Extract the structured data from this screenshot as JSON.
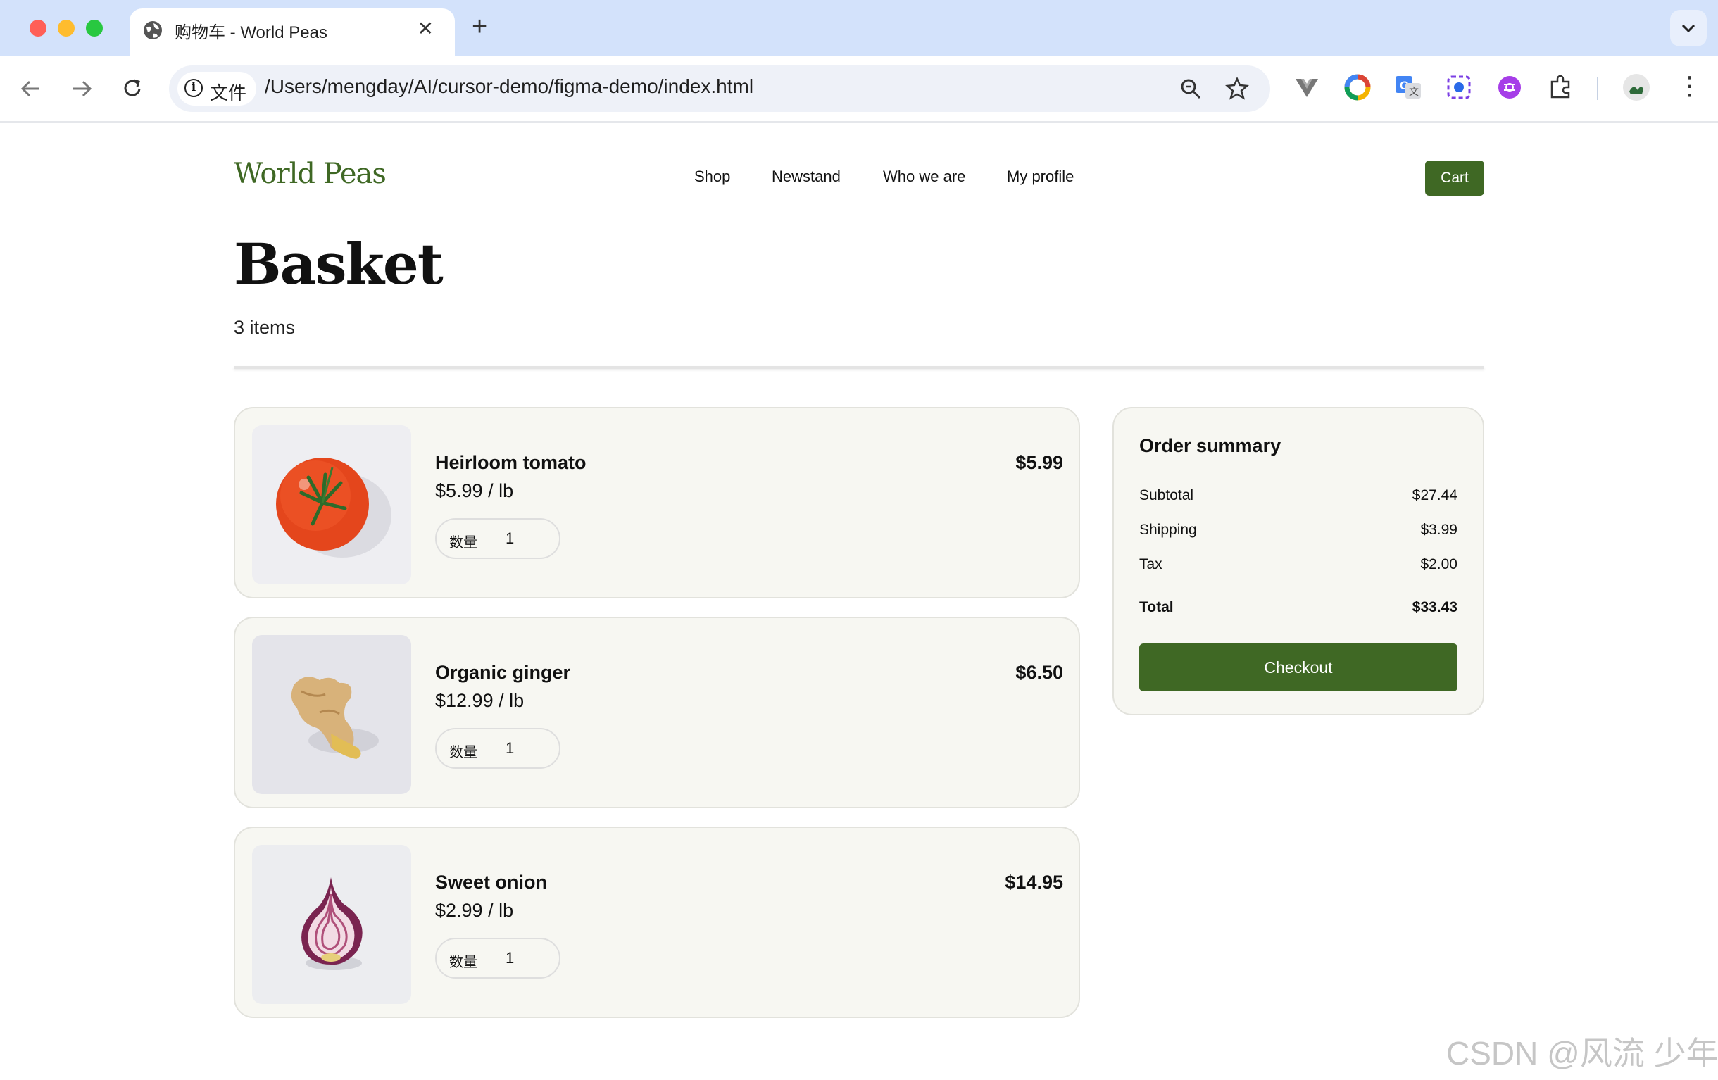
{
  "browser": {
    "tab_title": "购物车 - World Peas",
    "tab_close": "✕",
    "new_tab": "+",
    "site_chip_label": "文件",
    "url": "/Users/mengday/AI/cursor-demo/figma-demo/index.html"
  },
  "header": {
    "logo": "World Peas",
    "nav": [
      "Shop",
      "Newstand",
      "Who we are",
      "My profile"
    ],
    "cart_label": "Cart"
  },
  "basket": {
    "title": "Basket",
    "count": "3 items",
    "items": [
      {
        "name": "Heirloom tomato",
        "unit_price": "$5.99 / lb",
        "qty_label": "数量",
        "qty": "1",
        "price": "$5.99",
        "image": "tomato"
      },
      {
        "name": "Organic ginger",
        "unit_price": "$12.99 / lb",
        "qty_label": "数量",
        "qty": "1",
        "price": "$6.50",
        "image": "ginger"
      },
      {
        "name": "Sweet onion",
        "unit_price": "$2.99 / lb",
        "qty_label": "数量",
        "qty": "1",
        "price": "$14.95",
        "image": "onion"
      }
    ]
  },
  "summary": {
    "title": "Order summary",
    "subtotal_label": "Subtotal",
    "subtotal": "$27.44",
    "shipping_label": "Shipping",
    "shipping": "$3.99",
    "tax_label": "Tax",
    "tax": "$2.00",
    "total_label": "Total",
    "total": "$33.43",
    "checkout_label": "Checkout"
  },
  "watermark": "CSDN @风流 少年",
  "colors": {
    "accent": "#3f6824",
    "card_bg": "#f7f7f2",
    "tab_bar": "#d3e2fb"
  }
}
